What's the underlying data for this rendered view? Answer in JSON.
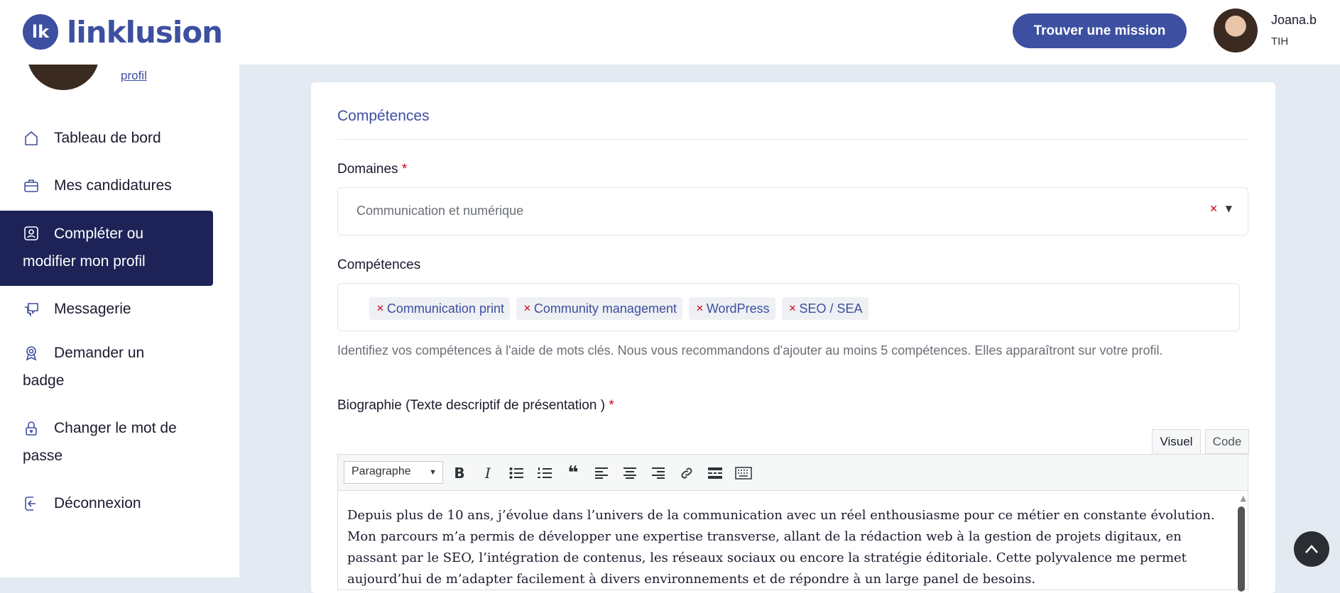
{
  "header": {
    "logo_mark": "lk",
    "logo_text_a": "lin",
    "logo_text_b": "klusion",
    "cta_label": "Trouver une mission",
    "user_name": "Joana.b",
    "user_role": "TIH"
  },
  "sidebar": {
    "profile_link": "profil",
    "items": [
      {
        "label": "Tableau de bord",
        "icon": "home-icon"
      },
      {
        "label": "Mes candidatures",
        "icon": "briefcase-icon"
      },
      {
        "label": "Compléter ou modifier mon profil",
        "icon": "user-card-icon"
      },
      {
        "label": "Messagerie",
        "icon": "chat-icon"
      },
      {
        "label": "Demander un badge",
        "icon": "badge-icon"
      },
      {
        "label": "Changer le mot de passe",
        "icon": "lock-icon"
      },
      {
        "label": "Déconnexion",
        "icon": "logout-icon"
      }
    ]
  },
  "form": {
    "section_title": "Compétences",
    "domaines_label": "Domaines",
    "required_mark": "*",
    "domaines_value": "Communication et numérique",
    "competences_label": "Compétences",
    "tags": [
      "Communication print",
      "Community management",
      "WordPress",
      "SEO / SEA"
    ],
    "helper": "Identifiez vos compétences à l'aide de mots clés. Nous vous recommandons d'ajouter au moins 5 compétences. Elles apparaîtront sur votre profil.",
    "bio_label": "Biographie (Texte descriptif de présentation )",
    "tab_visual": "Visuel",
    "tab_code": "Code",
    "format_select": "Paragraphe",
    "bio_text": "Depuis plus de 10 ans, j’évolue dans l’univers de la communication avec un réel enthousiasme pour ce métier en constante évolution. Mon parcours m’a permis de développer une expertise transverse, allant de la rédaction web à la gestion de projets digitaux, en passant par le SEO, l’intégration de contenus, les réseaux sociaux ou encore la stratégie éditoriale. Cette polyvalence me permet aujourd’hui de m’adapter facilement à divers environnements et de répondre à un large panel de besoins."
  },
  "colors": {
    "primary": "#3d4fa0",
    "active_nav": "#1d2357",
    "required": "#d0021b"
  }
}
